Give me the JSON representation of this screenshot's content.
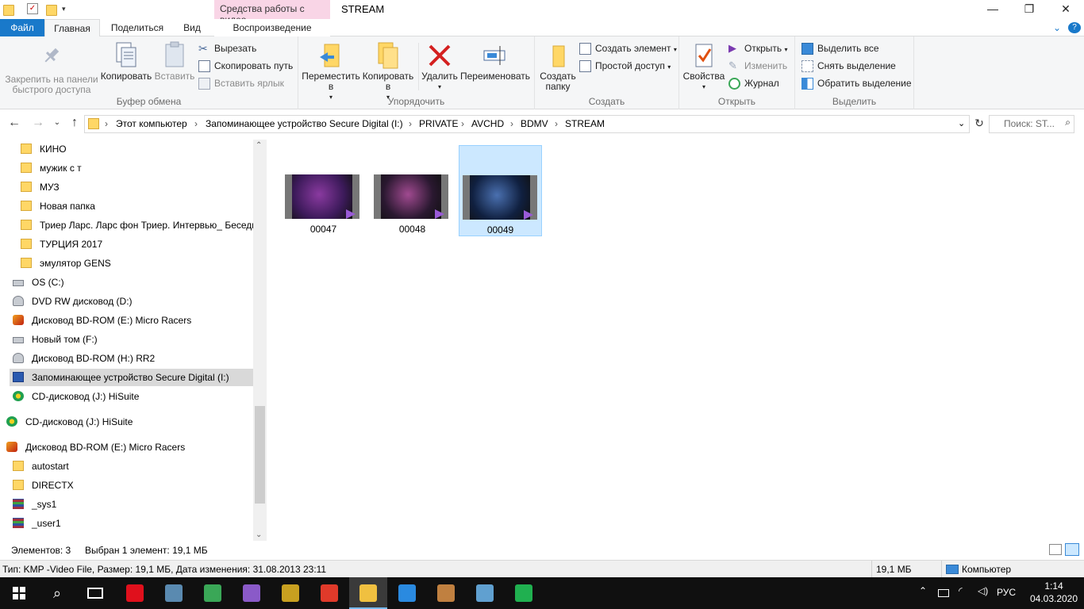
{
  "window": {
    "context_tab": "Средства работы с видео",
    "title": "STREAM",
    "controls": {
      "minimize": "—",
      "maximize": "❐",
      "close": "✕"
    }
  },
  "tabs": {
    "file": "Файл",
    "home": "Главная",
    "share": "Поделиться",
    "view": "Вид",
    "playback": "Воспроизведение"
  },
  "ribbon": {
    "clipboard": {
      "label": "Буфер обмена",
      "pin": "Закрепить на панели быстрого доступа",
      "copy": "Копировать",
      "paste": "Вставить",
      "cut": "Вырезать",
      "copy_path": "Скопировать путь",
      "paste_shortcut": "Вставить ярлык"
    },
    "organize": {
      "label": "Упорядочить",
      "move_to": "Переместить в",
      "copy_to": "Копировать в",
      "delete": "Удалить",
      "rename": "Переименовать"
    },
    "new": {
      "label": "Создать",
      "new_folder": "Создать папку",
      "new_item": "Создать элемент",
      "easy_access": "Простой доступ"
    },
    "open": {
      "label": "Открыть",
      "properties": "Свойства",
      "open": "Открыть",
      "edit": "Изменить",
      "history": "Журнал"
    },
    "select": {
      "label": "Выделить",
      "select_all": "Выделить все",
      "select_none": "Снять выделение",
      "invert": "Обратить выделение"
    }
  },
  "address": {
    "crumbs": [
      "Этот компьютер",
      "Запоминающее устройство Secure Digital (I:)",
      "PRIVATE",
      "AVCHD",
      "BDMV",
      "STREAM"
    ],
    "search_placeholder": "Поиск: ST..."
  },
  "nav": [
    {
      "label": "КИНО",
      "icon": "folder-icon"
    },
    {
      "label": "мужик с т",
      "icon": "folder-icon"
    },
    {
      "label": "МУЗ",
      "icon": "folder-icon"
    },
    {
      "label": "Новая папка",
      "icon": "folder-icon"
    },
    {
      "label": "Триер Ларс. Ларс фон Триер. Интервью_ Беседы",
      "icon": "folder-icon"
    },
    {
      "label": "ТУРЦИЯ 2017",
      "icon": "folder-icon"
    },
    {
      "label": "эмулятор GENS",
      "icon": "folder-icon"
    },
    {
      "label": "OS (C:)",
      "icon": "drive-icon"
    },
    {
      "label": "DVD RW дисковод (D:)",
      "icon": "dvd-drive-icon"
    },
    {
      "label": "Дисковод BD-ROM (E:) Micro Racers",
      "icon": "game-disc-icon"
    },
    {
      "label": "Новый том (F:)",
      "icon": "drive-icon"
    },
    {
      "label": "Дисковод BD-ROM (H:) RR2",
      "icon": "dvd-drive-icon"
    },
    {
      "label": "Запоминающее устройство Secure Digital (I:)",
      "icon": "sd-card-icon"
    },
    {
      "label": "CD-дисковод (J:) HiSuite",
      "icon": "hisuite-icon"
    },
    {
      "label": "CD-дисковод (J:) HiSuite",
      "icon": "hisuite-icon"
    },
    {
      "label": "Дисковод BD-ROM (E:) Micro Racers",
      "icon": "game-disc-icon"
    },
    {
      "label": "autostart",
      "icon": "folder-icon"
    },
    {
      "label": "DIRECTX",
      "icon": "folder-icon"
    },
    {
      "label": "_sys1",
      "icon": "archive-icon"
    },
    {
      "label": "_user1",
      "icon": "archive-icon"
    }
  ],
  "files": [
    {
      "name": "00047",
      "colors": [
        "#3c1a5a",
        "#8a3aa0"
      ]
    },
    {
      "name": "00048",
      "colors": [
        "#2a1830",
        "#a04a90"
      ]
    },
    {
      "name": "00049",
      "colors": [
        "#102040",
        "#4a70b0"
      ]
    }
  ],
  "status": {
    "items": "Элементов: 3",
    "selected": "Выбран 1 элемент: 19,1 МБ",
    "info": "Тип: KMP -Video File, Размер: 19,1 МБ, Дата изменения: 31.08.2013 23:11",
    "size": "19,1 МБ",
    "computer": "Компьютер"
  },
  "taskbar": {
    "lang": "РУС",
    "time": "1:14",
    "date": "04.03.2020",
    "apps": [
      {
        "name": "opera-icon",
        "color": "#e0101c"
      },
      {
        "name": "photos-icon",
        "color": "#5a8ab0"
      },
      {
        "name": "chrome-icon",
        "color": "#3aa757"
      },
      {
        "name": "visual-studio-icon",
        "color": "#8a5ac8"
      },
      {
        "name": "movie-maker-icon",
        "color": "#c8a020"
      },
      {
        "name": "yandex-browser-icon",
        "color": "#e03a2a"
      },
      {
        "name": "file-explorer-icon",
        "color": "#f0c040"
      },
      {
        "name": "lightning-app-icon",
        "color": "#2a8ae0"
      },
      {
        "name": "game-app-icon",
        "color": "#c08040"
      },
      {
        "name": "paint-icon",
        "color": "#60a0d0"
      },
      {
        "name": "shield-app-icon",
        "color": "#20b050"
      }
    ]
  }
}
